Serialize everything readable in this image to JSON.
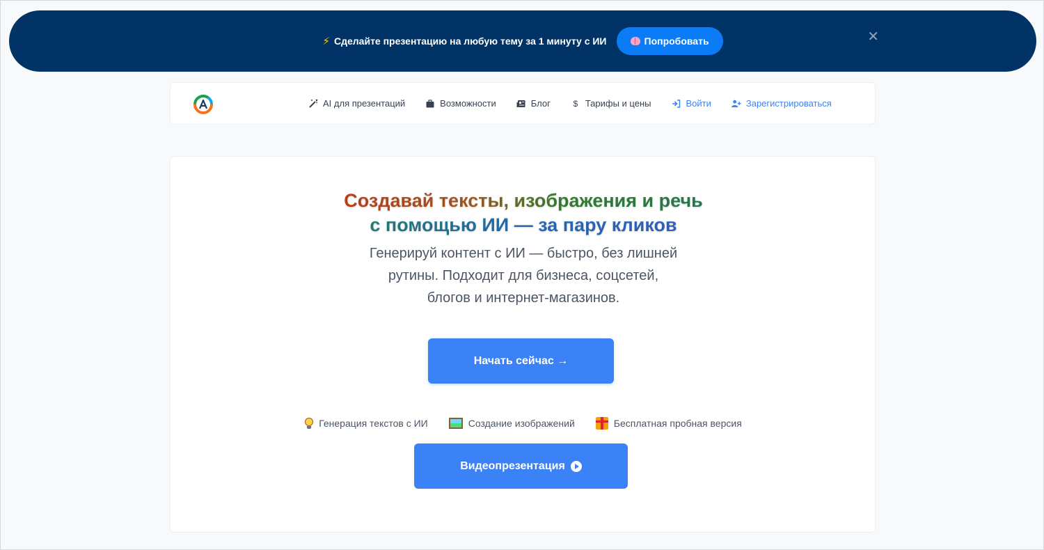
{
  "promo": {
    "text": "Сделайте презентацию на любую тему за 1 минуту с ИИ",
    "button_label": "Попробовать",
    "close_glyph": "✕"
  },
  "nav": {
    "items": [
      {
        "label": "AI для презентаций",
        "icon": "magic-wand-icon"
      },
      {
        "label": "Возможности",
        "icon": "briefcase-icon"
      },
      {
        "label": "Блог",
        "icon": "newspaper-icon"
      },
      {
        "label": "Тарифы и цены",
        "icon": "dollar-icon"
      },
      {
        "label": "Войти",
        "icon": "sign-in-icon"
      },
      {
        "label": "Зарегистрироваться",
        "icon": "user-plus-icon"
      }
    ]
  },
  "hero": {
    "headline_line1_part1": "Создавай тексты,",
    "headline_line1_part2": " изображения и речь",
    "headline_line2": "с помощью ИИ — за пару кликов",
    "subtitle_line1": "Генерируй контент с ИИ — быстро, без лишней",
    "subtitle_line2": "рутины. Подходит для бизнеса, соцсетей,",
    "subtitle_line3": "блогов и интернет-магазинов.",
    "cta_label": "Начать сейчас →",
    "features": [
      {
        "label": "Генерация текстов с ИИ",
        "icon": "lightbulb-icon"
      },
      {
        "label": "Создание изображений",
        "icon": "picture-icon"
      },
      {
        "label": "Бесплатная пробная версия",
        "icon": "gift-icon"
      }
    ],
    "video_label": "Видеопрезентация"
  },
  "colors": {
    "banner_bg": "#023366",
    "accent": "#3b82f6",
    "promo_button": "#0b7cf5"
  }
}
